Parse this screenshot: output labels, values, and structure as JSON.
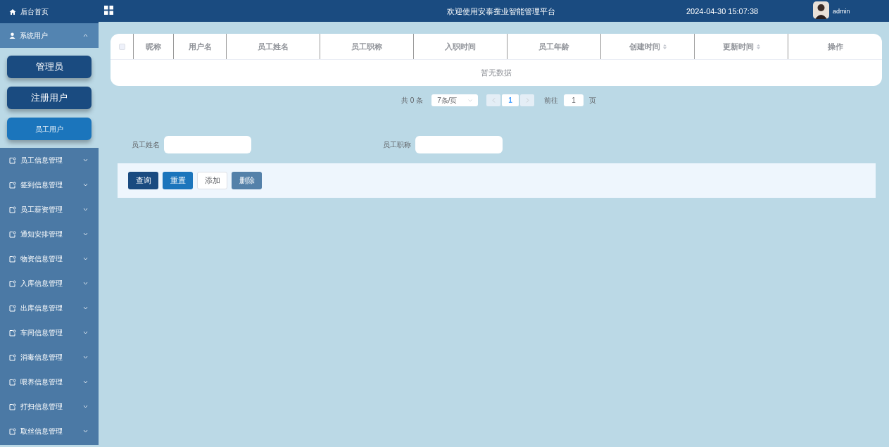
{
  "sidebar": {
    "home": "后台首页",
    "groups": [
      {
        "label": "系统用户",
        "expanded": true,
        "children": [
          {
            "label": "管理员",
            "selected": false
          },
          {
            "label": "注册用户",
            "selected": false
          },
          {
            "label": "员工用户",
            "selected": true
          }
        ]
      },
      {
        "label": "员工信息管理",
        "expanded": false
      },
      {
        "label": "签到信息管理",
        "expanded": false
      },
      {
        "label": "员工薪资管理",
        "expanded": false
      },
      {
        "label": "通知安排管理",
        "expanded": false
      },
      {
        "label": "物资信息管理",
        "expanded": false
      },
      {
        "label": "入库信息管理",
        "expanded": false
      },
      {
        "label": "出库信息管理",
        "expanded": false
      },
      {
        "label": "车间信息管理",
        "expanded": false
      },
      {
        "label": "消毒信息管理",
        "expanded": false
      },
      {
        "label": "喂养信息管理",
        "expanded": false
      },
      {
        "label": "打扫信息管理",
        "expanded": false
      },
      {
        "label": "取丝信息管理",
        "expanded": false
      }
    ]
  },
  "header": {
    "title": "欢迎使用安泰蚕业智能管理平台",
    "datetime": "2024-04-30 15:07:38",
    "user": "admin"
  },
  "table": {
    "select_all": {
      "checked": false
    },
    "columns": [
      {
        "label": "昵称",
        "sortable": false
      },
      {
        "label": "用户名",
        "sortable": false
      },
      {
        "label": "员工姓名",
        "sortable": false
      },
      {
        "label": "员工职称",
        "sortable": false
      },
      {
        "label": "入职时间",
        "sortable": false
      },
      {
        "label": "员工年龄",
        "sortable": false
      },
      {
        "label": "创建时间",
        "sortable": true
      },
      {
        "label": "更新时间",
        "sortable": true
      },
      {
        "label": "操作",
        "sortable": false
      }
    ],
    "empty_text": "暂无数据"
  },
  "pagination": {
    "total": "共 0 条",
    "page_size": "7条/页",
    "pages": [
      {
        "label": "1",
        "selected": true
      }
    ],
    "goto_label": "前往",
    "goto_value": "1",
    "goto_suffix": "页"
  },
  "search": {
    "fields": [
      {
        "label": "员工姓名"
      },
      {
        "label": "员工职称"
      }
    ]
  },
  "buttons": [
    {
      "label": "查询",
      "kind": "primary"
    },
    {
      "label": "重置",
      "kind": "info"
    },
    {
      "label": "添加",
      "kind": "plain"
    },
    {
      "label": "删除",
      "kind": "muted"
    }
  ]
}
